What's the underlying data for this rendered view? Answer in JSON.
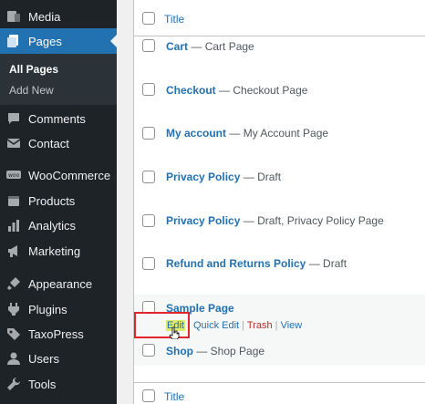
{
  "sidebar": {
    "items": [
      {
        "label": "Media",
        "icon": "media-icon"
      },
      {
        "label": "Pages",
        "icon": "pages-icon"
      },
      {
        "label": "Comments",
        "icon": "comments-icon"
      },
      {
        "label": "Contact",
        "icon": "contact-icon"
      },
      {
        "label": "WooCommerce",
        "icon": "woocommerce-icon"
      },
      {
        "label": "Products",
        "icon": "products-icon"
      },
      {
        "label": "Analytics",
        "icon": "analytics-icon"
      },
      {
        "label": "Marketing",
        "icon": "marketing-icon"
      },
      {
        "label": "Appearance",
        "icon": "appearance-icon"
      },
      {
        "label": "Plugins",
        "icon": "plugins-icon"
      },
      {
        "label": "TaxoPress",
        "icon": "taxopress-icon"
      },
      {
        "label": "Users",
        "icon": "users-icon"
      },
      {
        "label": "Tools",
        "icon": "tools-icon"
      }
    ],
    "submenu": {
      "all_pages": "All Pages",
      "add_new": "Add New"
    }
  },
  "table": {
    "column_title": "Title",
    "footer_title": "Title",
    "rows": [
      {
        "title": "Cart",
        "state": "— Cart Page"
      },
      {
        "title": "Checkout",
        "state": "— Checkout Page"
      },
      {
        "title": "My account",
        "state": "— My Account Page"
      },
      {
        "title": "Privacy Policy",
        "state": "— Draft"
      },
      {
        "title": "Privacy Policy",
        "state": "— Draft, Privacy Policy Page"
      },
      {
        "title": "Refund and Returns Policy",
        "state": "— Draft"
      },
      {
        "title": "Sample Page",
        "state": ""
      },
      {
        "title": "Shop",
        "state": "— Shop Page"
      }
    ],
    "row_actions": {
      "edit": "Edit",
      "quick_edit": "Quick Edit",
      "trash": "Trash",
      "view": "View",
      "sep": " | "
    }
  },
  "colors": {
    "sidebar_bg": "#1d2327",
    "active_bg": "#2271b1",
    "link": "#2271b1",
    "trash": "#b32d2e",
    "highlight_box": "#e0262b"
  }
}
